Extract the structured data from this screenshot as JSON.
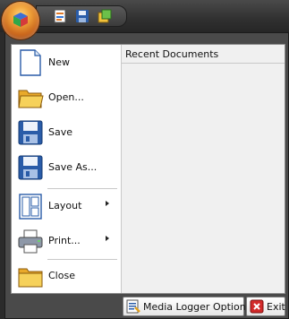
{
  "quick_access": {
    "icons": [
      "sheet-icon",
      "save-icon",
      "cascade-icon"
    ]
  },
  "menu": {
    "items": [
      {
        "label": "New",
        "icon": "new-document-icon"
      },
      {
        "label": "Open...",
        "icon": "open-folder-icon"
      },
      {
        "label": "Save",
        "icon": "save-icon"
      },
      {
        "label": "Save As...",
        "icon": "save-as-icon"
      },
      {
        "label": "Layout",
        "icon": "layout-icon",
        "submenu": true
      },
      {
        "label": "Print...",
        "icon": "printer-icon",
        "submenu": true
      },
      {
        "label": "Close",
        "icon": "close-folder-icon"
      }
    ],
    "recent_header": "Recent Documents"
  },
  "footer": {
    "options_label": "Media Logger Options",
    "exit_label": "Exit"
  },
  "colors": {
    "accent_orange": "#f0a23a",
    "frame_dark": "#4a4a4a",
    "pane_gray": "#f0f0f0",
    "icon_blue": "#2a5ca8",
    "folder_yellow": "#f2c23a",
    "exit_red": "#d22a2a"
  }
}
